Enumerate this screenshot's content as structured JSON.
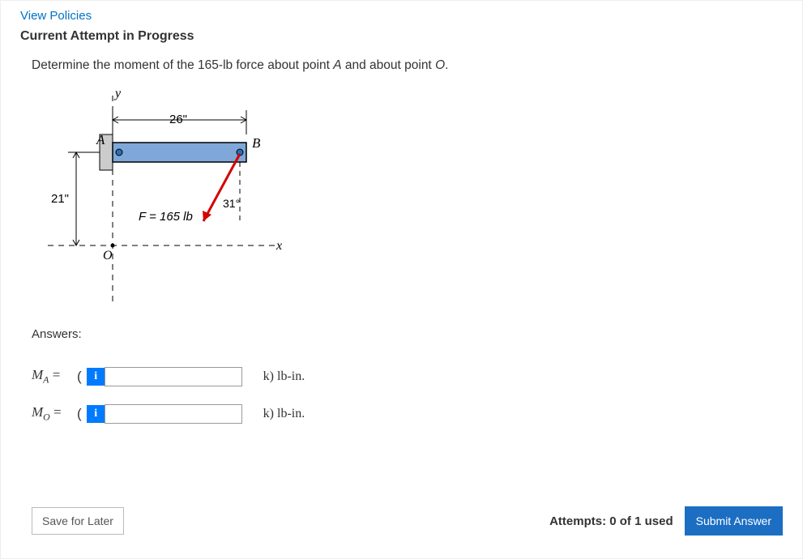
{
  "header": {
    "policies_link": "View Policies",
    "title": "Current Attempt in Progress"
  },
  "prompt": {
    "pre": "Determine the moment of the 165-lb force about point ",
    "pointA": "A",
    "mid": " and about point ",
    "pointO": "O",
    "post": "."
  },
  "diagram": {
    "y_label": "y",
    "x_label": "x",
    "O_label": "O",
    "A_label": "A",
    "B_label": "B",
    "dim_horiz": "26\"",
    "dim_vert": "21\"",
    "angle": "31°",
    "force_label": "F = 165 lb"
  },
  "answers": {
    "label": "Answers:",
    "rows": [
      {
        "sym": "M",
        "sub": "A",
        "unit": "k) lb-in.",
        "value": ""
      },
      {
        "sym": "M",
        "sub": "O",
        "unit": "k) lb-in.",
        "value": ""
      }
    ]
  },
  "footer": {
    "save": "Save for Later",
    "attempts": "Attempts: 0 of 1 used",
    "submit": "Submit Answer"
  },
  "info_glyph": "i",
  "equals": " = ",
  "open_paren": "("
}
